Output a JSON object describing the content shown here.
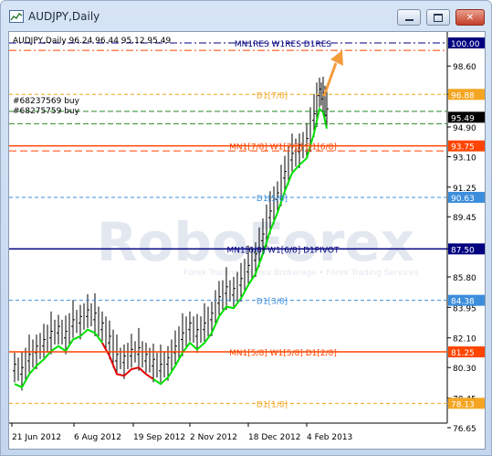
{
  "window": {
    "title": "AUDJPY,Daily"
  },
  "chart": {
    "header": "AUDJPY,Daily  96.24 96.44 95.12 95.49",
    "watermark": "RoboForex",
    "watermark_sub": "Forex Trading • Forex Brokerage • Forex Trading Services",
    "orders": [
      "#68237569 buy",
      "#68275759 buy"
    ],
    "x_ticks": [
      "21 Jun 2012",
      "6 Aug 2012",
      "19 Sep 2012",
      "2 Nov 2012",
      "18 Dec 2012",
      "4 Feb 2013"
    ],
    "y_ticks": [
      "98.60",
      "96.88",
      "94.90",
      "93.10",
      "91.25",
      "89.45",
      "87.50",
      "85.80",
      "83.95",
      "82.10",
      "80.30",
      "78.45",
      "76.65"
    ],
    "levels": [
      {
        "name": "100.00",
        "label": "MN1RES W1RES D1RES",
        "color": "#000080",
        "boxed": true
      },
      {
        "name": "96.88",
        "label": "D1[7/8]",
        "color": "#f4a622",
        "boxed": true
      },
      {
        "name": "95.49",
        "label": "",
        "color": "#000000",
        "boxed": true
      },
      {
        "name": "93.75",
        "label": "MN1[7/8] W1[7/8] D1[6/8]",
        "color": "#ff4500",
        "boxed": true
      },
      {
        "name": "90.63",
        "label": "D1[5/8]",
        "color": "#3c8edc",
        "boxed": true
      },
      {
        "name": "87.50",
        "label": "MN1[6/8] W1[6/8] D1PIVOT",
        "color": "#000080",
        "boxed": true
      },
      {
        "name": "84.38",
        "label": "D1[3/8]",
        "color": "#3c8edc",
        "boxed": true
      },
      {
        "name": "81.25",
        "label": "MN1[5/8] W1[5/8] D1[2/8]",
        "color": "#ff4500",
        "boxed": true
      },
      {
        "name": "78.13",
        "label": "D1[1/8]",
        "color": "#f4a622",
        "boxed": true
      }
    ],
    "colors": {
      "trend_line": "#00e000",
      "trend_red": "#e00000",
      "arrow": "#f39c3c",
      "watermark": "#e3e8f0"
    }
  }
}
